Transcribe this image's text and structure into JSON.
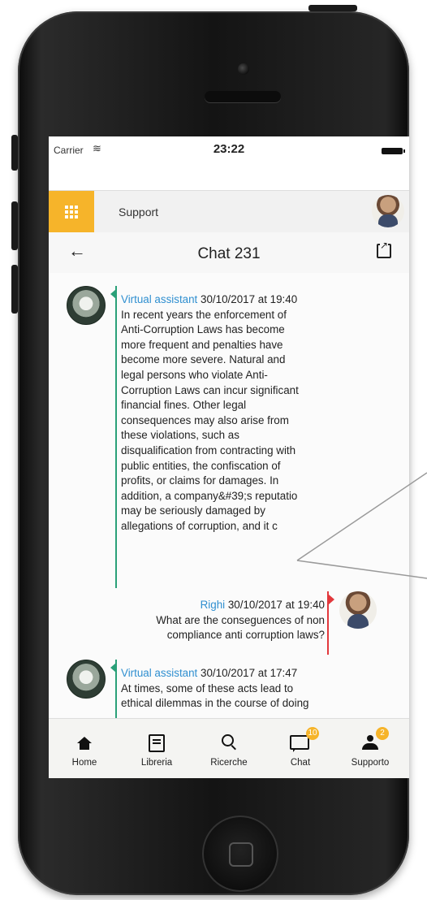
{
  "statusbar": {
    "carrier": "Carrier",
    "time": "23:22"
  },
  "topbar": {
    "section": "Support"
  },
  "chat": {
    "title": "Chat 231"
  },
  "messages": [
    {
      "sender": "Virtual assistant",
      "timestamp": "30/10/2017 at 19:40",
      "lines": [
        "In recent years the enforcement of",
        "Anti-Corruption Laws has become",
        "more frequent and penalties have",
        "become more severe. Natural and",
        "legal persons who violate Anti-",
        "Corruption Laws can incur significant",
        "financial fines. Other legal",
        "consequences may also arise from",
        "these violations, such as",
        "disqualification from contracting with",
        "public entities, the confiscation of",
        "profits, or claims for damages. In",
        "addition, a company&#39;s reputatio",
        "may be seriously damaged by",
        "allegations of corruption, and it c"
      ]
    },
    {
      "sender": "Righi",
      "timestamp": "30/10/2017 at 19:40",
      "lines": [
        "What are the conseguences of non",
        "compliance anti corruption laws?"
      ]
    },
    {
      "sender": "Virtual assistant",
      "timestamp": "30/10/2017 at 17:47",
      "lines": [
        "At times, some of these acts lead to",
        "ethical dilemmas in the course of doing"
      ]
    }
  ],
  "nav": [
    {
      "label": "Home",
      "icon": "home-icon"
    },
    {
      "label": "Libreria",
      "icon": "library-icon"
    },
    {
      "label": "Ricerche",
      "icon": "search-icon"
    },
    {
      "label": "Chat",
      "icon": "chat-icon",
      "badge": "10"
    },
    {
      "label": "Supporto",
      "icon": "people-icon",
      "badge": "2"
    }
  ],
  "colors": {
    "accent": "#f6b42a",
    "link": "#2f8fd0",
    "bot_bar": "#2aa078",
    "user_bar": "#e2383c"
  }
}
